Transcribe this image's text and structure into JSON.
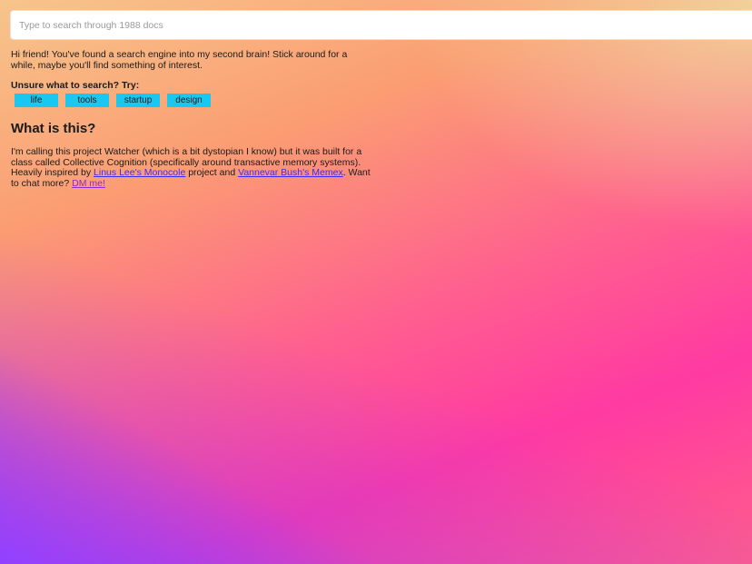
{
  "search": {
    "placeholder": "Type to search through 1988 docs",
    "value": ""
  },
  "intro": {
    "text": "Hi friend! You've found a search engine into my second brain! Stick around for a while, maybe you'll find something of interest."
  },
  "suggestions": {
    "label": "Unsure what to search? Try:",
    "items": [
      "life",
      "tools",
      "startup",
      "design"
    ]
  },
  "about": {
    "title": "What is this?",
    "text_1": "I'm calling this project Watcher (which is a bit dystopian I know) but it was built for a class called Collective Cognition (specifically around transactive memory systems). Heavily inspired by ",
    "link_monocole": "Linus Lee's Monocole",
    "text_2": " project and ",
    "link_memex": "Vannevar Bush's Memex",
    "text_3": ". Want to chat more? ",
    "link_dm": "DM me!"
  },
  "colors": {
    "chip": "#19c8f0",
    "link": "#3b2bff",
    "link_visited": "#8a2bd0",
    "gradient_top": "#f7c58c",
    "gradient_mid": "#ff3aa2",
    "gradient_bottom_left": "#8c46ff"
  }
}
